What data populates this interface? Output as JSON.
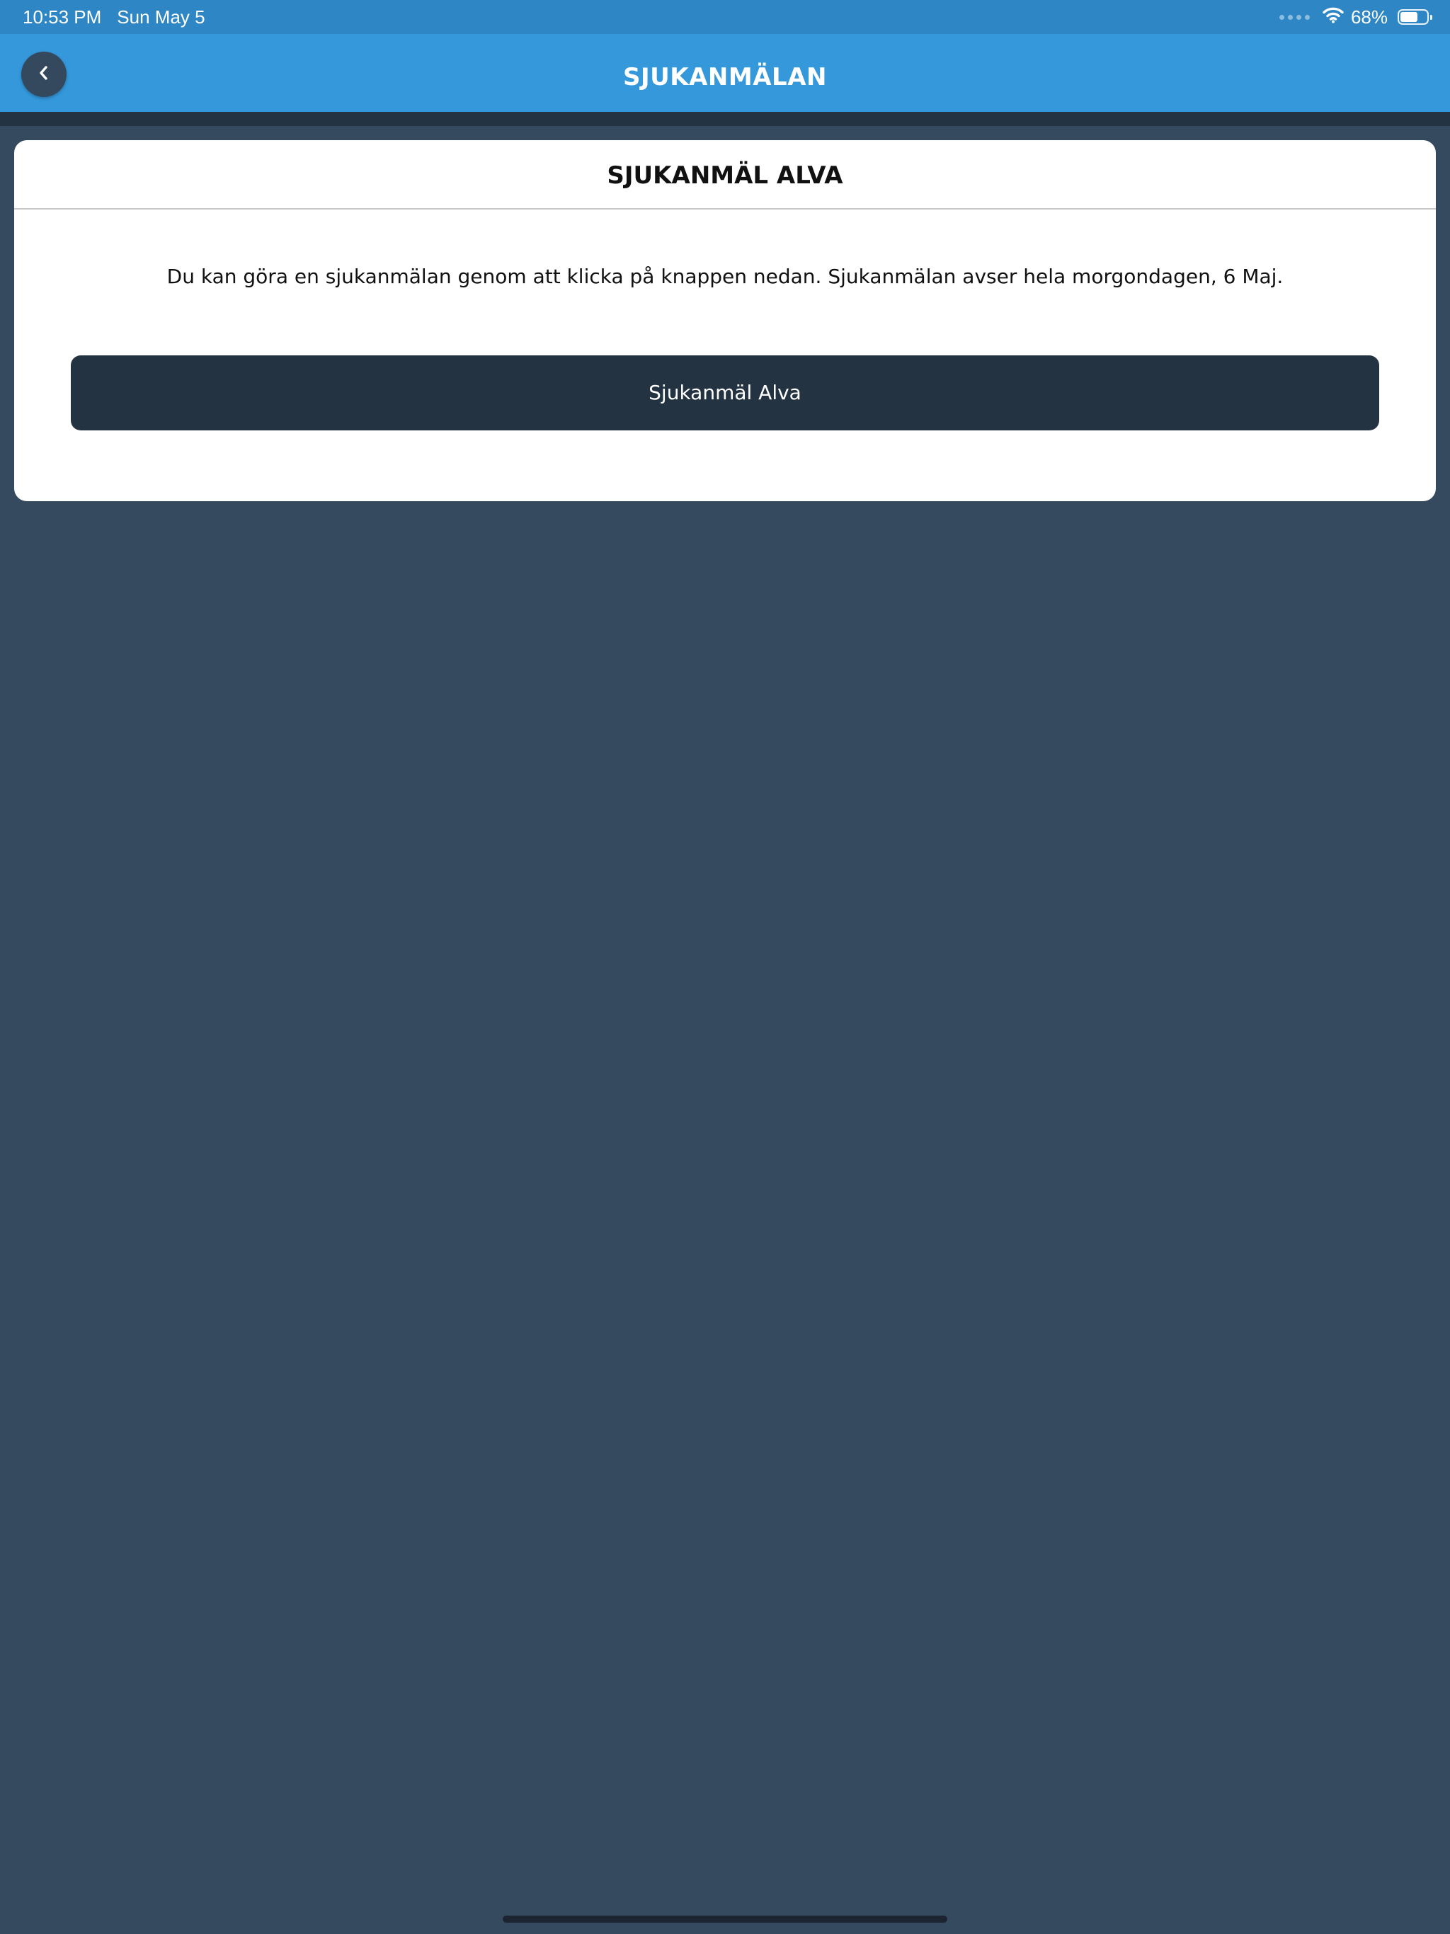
{
  "status_bar": {
    "time": "10:53 PM",
    "date": "Sun May 5",
    "battery_percent_text": "68%",
    "battery_level": 0.68,
    "icons": [
      "cellular-signal-icon",
      "wifi-icon",
      "battery-icon"
    ]
  },
  "nav": {
    "title": "SJUKANMÄLAN",
    "back_icon": "chevron-left-icon"
  },
  "card": {
    "title": "SJUKANMÄL ALVA",
    "description": "Du kan göra en sjukanmälan genom att klicka på knappen nedan. Sjukanmälan avser hela morgondagen, 6 Maj.",
    "button_label": "Sjukanmäl Alva"
  },
  "colors": {
    "status_bar": "#2e86c4",
    "nav_bar": "#3498db",
    "background": "#354a5f",
    "button": "#243342",
    "card": "#ffffff"
  }
}
